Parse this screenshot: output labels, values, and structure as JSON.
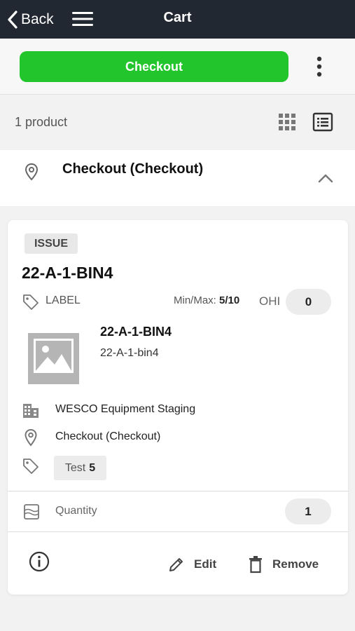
{
  "header": {
    "back_label": "Back",
    "title": "Cart",
    "back_icon": "chevron-left-icon",
    "menu_icon": "hamburger-icon"
  },
  "actions": {
    "checkout_label": "Checkout",
    "checkout_color": "#22c52b",
    "more_icon": "kebab-icon"
  },
  "summary": {
    "count_label": "1 product",
    "grid_icon": "grid-view-icon",
    "list_icon": "list-view-icon"
  },
  "group": {
    "title": "Checkout (Checkout)",
    "icon": "location-pin-icon",
    "expanded": true
  },
  "item": {
    "badge": "ISSUE",
    "title": "22-A-1-BIN4",
    "label": "LABEL",
    "minmax_label": "Min/Max:",
    "minmax_value": "5/10",
    "ohi_label": "OHI",
    "ohi_value": "0",
    "name": "22-A-1-BIN4",
    "subname": "22-A-1-bin4",
    "location_building": "WESCO Equipment Staging",
    "location_area": "Checkout (Checkout)",
    "tag_name": "Test",
    "tag_count": "5",
    "quantity_label": "Quantity",
    "quantity_value": "1",
    "edit_label": "Edit",
    "remove_label": "Remove"
  }
}
